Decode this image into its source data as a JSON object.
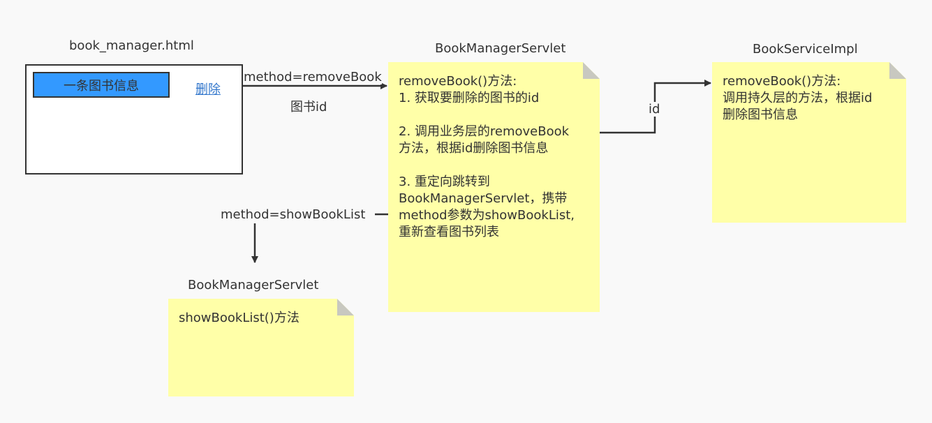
{
  "html_page": {
    "title": "book_manager.html",
    "book_item": "一条图书信息",
    "delete_link": "删除"
  },
  "servlet_remove": {
    "title": "BookManagerServlet",
    "lines": [
      "removeBook()方法:",
      "1. 获取要删除的图书的id",
      "",
      "2. 调用业务层的removeBook",
      "方法，根据id删除图书信息",
      "",
      "3. 重定向跳转到",
      "BookManagerServlet，携带",
      "method参数为showBookList,",
      "重新查看图书列表"
    ]
  },
  "service_impl": {
    "title": "BookServiceImpl",
    "lines": [
      "removeBook()方法:",
      "调用持久层的方法，根据id",
      "删除图书信息"
    ]
  },
  "servlet_show": {
    "title": "BookManagerServlet",
    "lines": [
      "showBookList()方法"
    ]
  },
  "edges": {
    "remove_method": "method=removeBook",
    "remove_param": "图书id",
    "id_label": "id",
    "show_method": "method=showBookList"
  },
  "colors": {
    "note_fill": "#ffffa8",
    "note_fold": "#c8c8c0",
    "book_button": "#3399ff",
    "stroke": "#333333",
    "link": "#3377cc"
  }
}
